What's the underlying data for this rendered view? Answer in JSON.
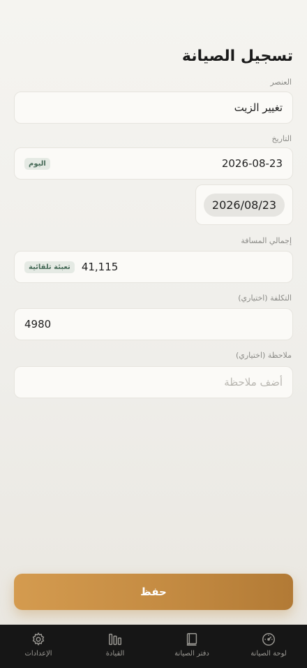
{
  "page": {
    "title": "تسجيل الصيانة"
  },
  "fields": {
    "item": {
      "label": "العنصر",
      "value": "تغيير الزيت"
    },
    "date": {
      "label": "التاريخ",
      "value": "2026-08-23",
      "today_badge": "اليوم",
      "picker_value": "2026/08/23"
    },
    "distance": {
      "label": "إجمالي المسافة",
      "value": "41,115",
      "auto_badge": "تعبئة تلقائية"
    },
    "cost": {
      "label": "التكلفة (اختياري)",
      "value": "4980"
    },
    "note": {
      "label": "ملاحظة (اختياري)",
      "placeholder": "أضف ملاحظة"
    }
  },
  "actions": {
    "save_label": "حفظ"
  },
  "tabbar": {
    "tabs": [
      {
        "label": "لوحة الصيانة",
        "icon": "speedometer-icon"
      },
      {
        "label": "دفتر الصيانة",
        "icon": "book-icon"
      },
      {
        "label": "القيادة",
        "icon": "bars-icon"
      },
      {
        "label": "الإعدادات",
        "icon": "gear-icon"
      }
    ]
  },
  "colors": {
    "accent": "#c48b42",
    "badge_text": "#466a57",
    "tabbar_bg": "#161616"
  }
}
